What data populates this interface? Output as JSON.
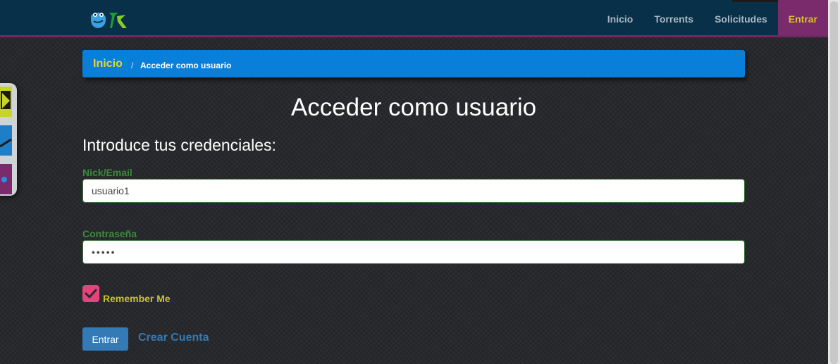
{
  "nav": {
    "items": [
      {
        "label": "Inicio"
      },
      {
        "label": "Torrents"
      },
      {
        "label": "Solicitudes"
      },
      {
        "label": "Entrar"
      }
    ],
    "active_color": "#7a2b6b"
  },
  "breadcrumb": {
    "home": "Inicio",
    "separator": "/",
    "current": "Acceder como usuario"
  },
  "page": {
    "title": "Acceder como usuario",
    "subtitle": "Introduce tus credenciales:"
  },
  "form": {
    "username_label": "Nick/Email",
    "username_value": "usuario1",
    "password_label": "Contraseña",
    "password_value": "•••••",
    "remember_label": "Remember Me",
    "remember_checked": true,
    "submit_label": "Entrar",
    "register_link": "Crear Cuenta"
  },
  "colors": {
    "navbar": "#083048",
    "accent": "#0a7fd9",
    "label_green": "#3b8a3b",
    "checkbox": "#e6437d",
    "button": "#337ab7"
  }
}
